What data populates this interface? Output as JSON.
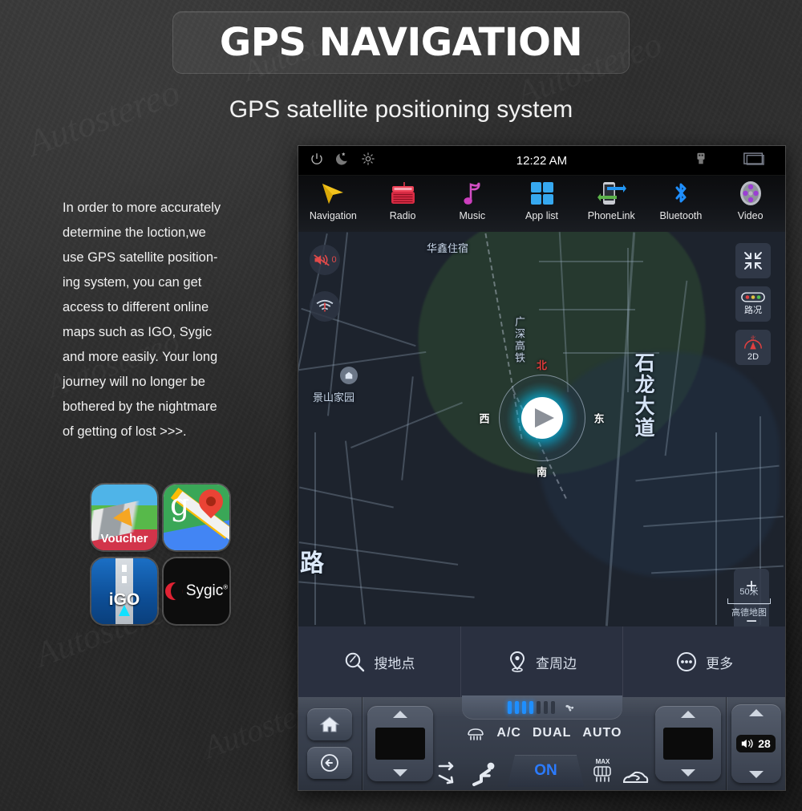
{
  "page": {
    "header_title": "GPS NAVIGATION",
    "subtitle": "GPS satellite positioning system",
    "watermark": "Autostereo"
  },
  "copy": {
    "lines": [
      "In order to more accurately",
      "determine the loction,we",
      "use GPS satellite position-",
      "ing system, you can get",
      "access to different online",
      "maps such as IGO, Sygic",
      "and more easily. Your long",
      "journey will no longer be",
      "bothered by the nightmare",
      "of getting of lost  >>>."
    ]
  },
  "app_icons": [
    {
      "name": "voucher-sygic-app",
      "label": "Voucher"
    },
    {
      "name": "google-maps-app",
      "label": "g"
    },
    {
      "name": "igo-app",
      "label": "iGO"
    },
    {
      "name": "sygic-app",
      "label": "Sygic"
    }
  ],
  "headunit": {
    "statusbar": {
      "clock": "12:22 AM",
      "left_icons": [
        "power-icon",
        "night-mode-icon",
        "brightness-icon"
      ],
      "right_icons": [
        "usb-icon",
        "display-icon"
      ]
    },
    "navapps": [
      {
        "label": "Navigation",
        "icon": "navigation-arrow-icon"
      },
      {
        "label": "Radio",
        "icon": "radio-icon"
      },
      {
        "label": "Music",
        "icon": "music-note-icon"
      },
      {
        "label": "App list",
        "icon": "app-grid-icon"
      },
      {
        "label": "PhoneLink",
        "icon": "phonelink-icon"
      },
      {
        "label": "Bluetooth",
        "icon": "bluetooth-icon"
      },
      {
        "label": "Video",
        "icon": "video-reel-icon"
      }
    ],
    "map": {
      "left_controls": [
        {
          "name": "mute-volume-button",
          "badge": "0"
        },
        {
          "name": "wifi-warning-button",
          "badge": ""
        }
      ],
      "right_controls": [
        {
          "name": "fullscreen-collapse-button",
          "label": ""
        },
        {
          "name": "traffic-button",
          "label": "路况"
        },
        {
          "name": "view-2d-button",
          "label": "2D",
          "compass_char": "北"
        }
      ],
      "zoom_in": "+",
      "zoom_out": "−",
      "scale_value": "50米",
      "map_provider": "高德地图",
      "compass": {
        "north": "北",
        "south": "南",
        "west": "西",
        "east": "东"
      },
      "labels": [
        {
          "text": "华鑫住宿",
          "name": "map-label-huaxin"
        },
        {
          "text": "景山家园",
          "name": "map-label-jingshan"
        },
        {
          "text": "广深高铁",
          "name": "map-label-railway"
        },
        {
          "text": "石龙大道",
          "name": "map-label-shilong-ave"
        },
        {
          "text": "路",
          "name": "map-label-road"
        }
      ],
      "bottom_bar": [
        {
          "label": "搜地点",
          "icon": "search-icon"
        },
        {
          "label": "查周边",
          "icon": "location-pin-icon"
        },
        {
          "label": "更多",
          "icon": "more-dots-icon"
        }
      ]
    },
    "climate": {
      "home_icon": "home-icon",
      "back_icon": "back-arrow-icon",
      "left_temp": "",
      "right_temp": "",
      "ac_label": "A/C",
      "dual_label": "DUAL",
      "auto_label": "AUTO",
      "on_label": "ON",
      "max_label": "MAX",
      "volume_value": "28",
      "fan_bars_on": 4,
      "fan_bars_total": 7,
      "icons": [
        "recirculate-icon",
        "airflow-body-icon",
        "front-defrost-icon",
        "rear-defrost-icon",
        "air-recirc-car-icon",
        "fan-icon",
        "volume-icon"
      ]
    }
  }
}
